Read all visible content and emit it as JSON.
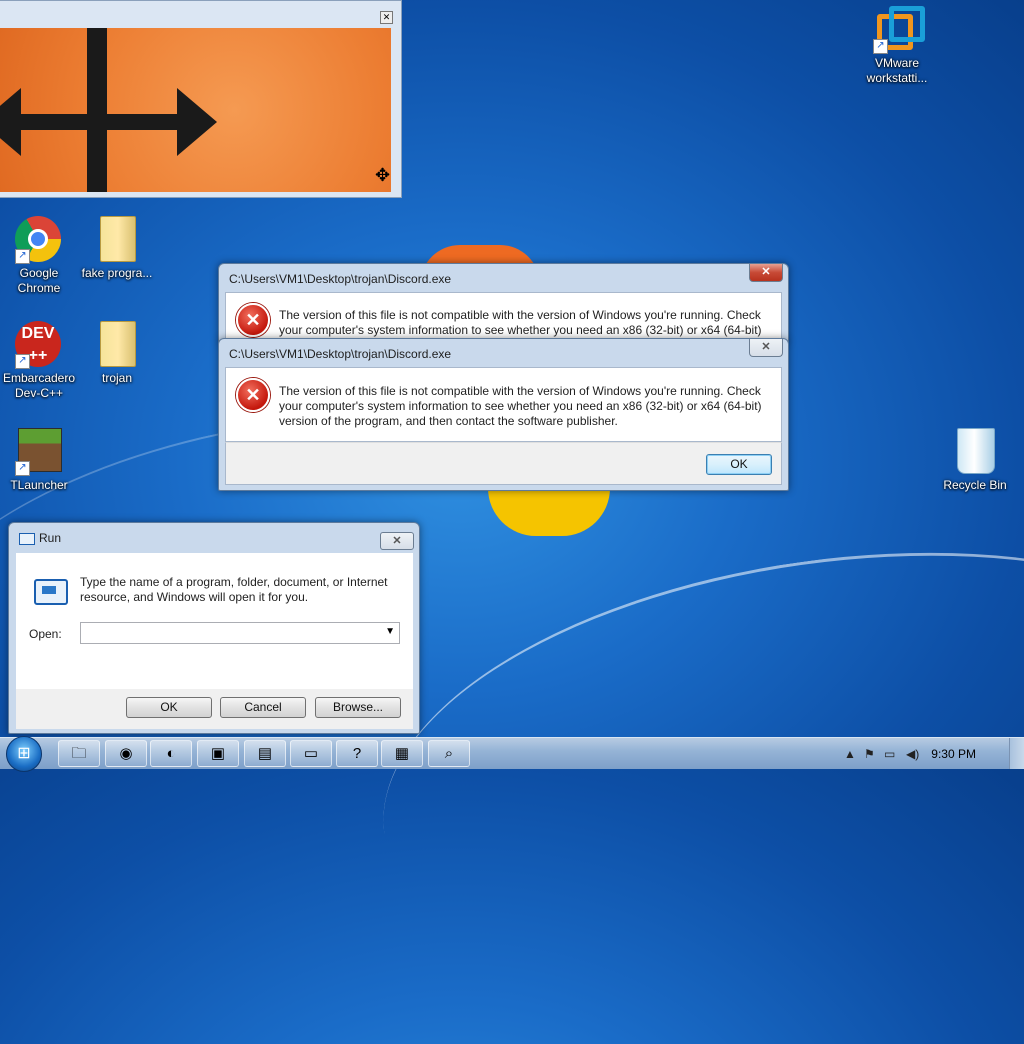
{
  "colors": {
    "error_red": "#c4170c",
    "titlebar": "#c9d9ec",
    "desktop": "#1a6cc8"
  },
  "desktop_icons": [
    {
      "label": "Google Chrome",
      "icon": "chrome-icon"
    },
    {
      "label": "fake progra...",
      "icon": "folder-icon"
    },
    {
      "label": "Embarcadero Dev-C++",
      "icon": "devcpp-icon",
      "text": "DEV\n++"
    },
    {
      "label": "trojan",
      "icon": "folder-icon"
    },
    {
      "label": "TLauncher",
      "icon": "minecraft-icon"
    },
    {
      "label": "VMware workstatti...",
      "icon": "vmware-icon"
    },
    {
      "label": "Recycle Bin",
      "icon": "recycle-bin-icon"
    }
  ],
  "dialog_back": {
    "title": "C:\\Users\\VM1\\Desktop\\trojan\\Discord.exe",
    "line1": "The version of this file is not compatible with the version of Windows you're running. Check",
    "line2": "your computer's system information to see whether you need an x86 (32-bit) or x64 (64-bit)"
  },
  "dialog_front": {
    "title": "C:\\Users\\VM1\\Desktop\\trojan\\Discord.exe",
    "line1": "The version of this file is not compatible with the version of Windows you're running. Check",
    "line2": "your computer's system information to see whether you need an x86 (32-bit) or x64 (64-bit)",
    "line3": "version of the program, and then contact the software publisher.",
    "ok_label": "OK"
  },
  "run_dialog": {
    "title": "Run",
    "desc_line1": "Type the name of a program, folder, document, or Internet",
    "desc_line2": "resource, and Windows will open it for you.",
    "open_label": "Open:",
    "open_value": "",
    "ok_label": "OK",
    "cancel_label": "Cancel",
    "browse_label": "Browse..."
  },
  "taskbar": {
    "items": [
      "explorer-icon",
      "chrome-icon",
      "firefox-icon",
      "vmware-icon",
      "notepad-icon",
      "run-icon",
      "help-icon",
      "control-panel-icon",
      "magnifier-icon"
    ],
    "clock": "9:30 PM"
  }
}
